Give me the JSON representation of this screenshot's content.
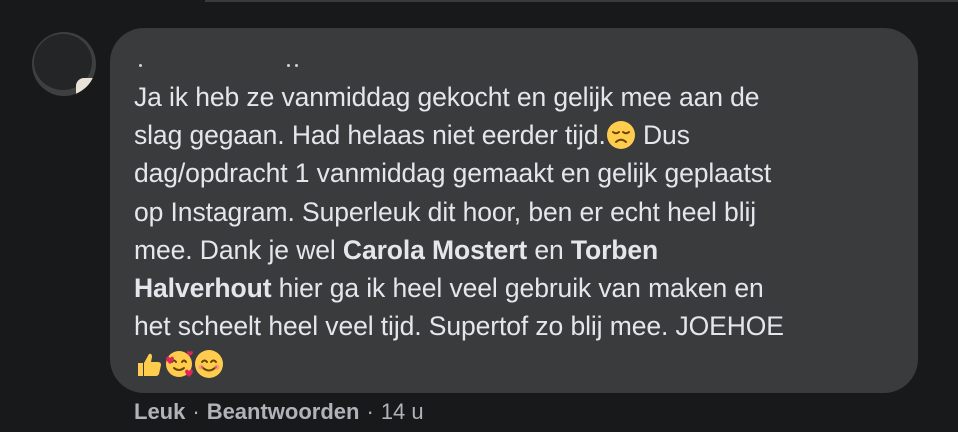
{
  "comment": {
    "author": "",
    "text": {
      "line1": "Ja ik heb ze vanmiddag gekocht en gelijk mee aan de",
      "line2": "slag gegaan. Had helaas niet eerder tijd.",
      "line2b": " Dus",
      "line3": "dag/opdracht 1 vanmiddag gemaakt en gelijk geplaatst",
      "line4": "op Instagram. Superleuk dit hoor, ben er echt heel blij",
      "line5": "mee. Dank je wel ",
      "mention1": "Carola Mostert",
      "line5b": " en ",
      "mention2_part1": "Torben",
      "mention2_part2": "Halverhout",
      "line6": " hier ga ik heel veel gebruik van maken en",
      "line7": "het scheelt heel veel tijd. Supertof zo blij mee. JOEHOE"
    },
    "emojis": {
      "disappointed": "disappointed-face-icon",
      "thumbs_up": "thumbs-up-icon",
      "hearts_face": "smiling-face-with-hearts-icon",
      "smile": "smiling-face-icon"
    }
  },
  "actions": {
    "like": "Leuk",
    "separator": "·",
    "reply": "Beantwoorden",
    "time": "14 u"
  },
  "colors": {
    "page_background": "#18191a",
    "bubble_background": "#3a3b3c",
    "text_primary": "#e4e6eb",
    "text_secondary": "#b0b3b8",
    "emoji_yellow": "#ffcc4d"
  }
}
